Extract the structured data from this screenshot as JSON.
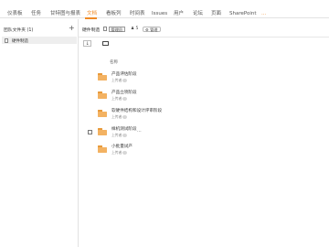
{
  "nav": {
    "items": [
      {
        "label": "仪表板"
      },
      {
        "label": "任务"
      },
      {
        "label": "甘特图与报表"
      },
      {
        "label": "文档",
        "active": true
      },
      {
        "label": "看板列"
      },
      {
        "label": "时间表"
      },
      {
        "label": "Issues"
      },
      {
        "label": "用户"
      },
      {
        "label": "论坛"
      },
      {
        "label": "页面"
      },
      {
        "label": "SharePoint"
      },
      {
        "label": "..."
      }
    ],
    "accent_color": "#f08a24"
  },
  "left_panel": {
    "title": "团队文件夹 (1)",
    "add_icon": "plus-icon",
    "items": [
      {
        "label": "硬件制造",
        "icon": "document-icon"
      }
    ]
  },
  "library": {
    "name": "硬件制造",
    "badge": "管理员",
    "members_count": "5",
    "members_icon": "people-icon",
    "manage_label": "管理",
    "manage_icon": "gear-icon"
  },
  "toolbar": {
    "sort_label": "↓",
    "sort_icon": "sort-icon",
    "new_folder_icon": "folder-icon"
  },
  "list": {
    "column_header": "名称",
    "folder_color": "#f3b262",
    "rows": [
      {
        "name": "产品评估阶段",
        "meta": "上传者"
      },
      {
        "name": "产品立项阶段",
        "meta": "上传者"
      },
      {
        "name": "软硬件结构和设计评审阶段",
        "meta": "上传者"
      },
      {
        "name": "样机测试阶段",
        "meta": "上传者",
        "more": "...",
        "hovered": true
      },
      {
        "name": "小批量试产",
        "meta": "上传者"
      }
    ]
  }
}
